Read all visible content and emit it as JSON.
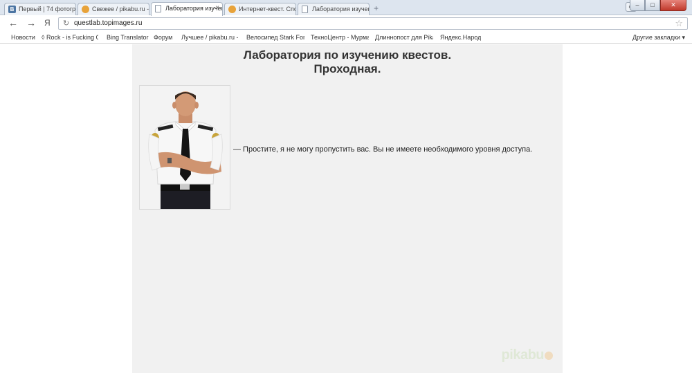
{
  "browser": {
    "tabs": [
      {
        "title": "Первый | 74 фотограф",
        "icon": "vk-icon",
        "active": false
      },
      {
        "title": "Свежее / pikabu.ru - I",
        "icon": "pikabu-icon",
        "active": false
      },
      {
        "title": "Лаборатория изучени",
        "icon": "document-icon",
        "active": true,
        "close": "×"
      },
      {
        "title": "Интернет-квест. Спо",
        "icon": "pikabu-icon",
        "active": false
      },
      {
        "title": "Лаборатория изучени",
        "icon": "document-icon",
        "active": false
      }
    ],
    "new_tab_label": "+",
    "url": "questlab.topimages.ru",
    "back_glyph": "←",
    "forward_glyph": "→",
    "yandex_glyph": "Я",
    "reload_glyph": "↻",
    "star_glyph": "☆",
    "bookmarks": [
      "Новости",
      "◊ Rock - is Fucking G",
      "Bing Translator",
      "Форум",
      "Лучшее / pikabu.ru -",
      "Велосипед Stark Fort",
      "ТехноЦентр - Мурма",
      "Длиннопост для Pika",
      "Яндекс.Народ"
    ],
    "other_bookmarks": "Другие закладки ▾"
  },
  "page": {
    "title_line1": "Лаборатория по изучению квестов.",
    "title_line2": "Проходная.",
    "message": "— Простите, я не могу пропустить вас. Вы не имеете необходимого уровня доступа.",
    "watermark": "pikabu"
  },
  "colors": {
    "panel_bg": "#f1f1f1",
    "title_text": "#333333",
    "tabstrip_bg": "#dde5ef"
  }
}
